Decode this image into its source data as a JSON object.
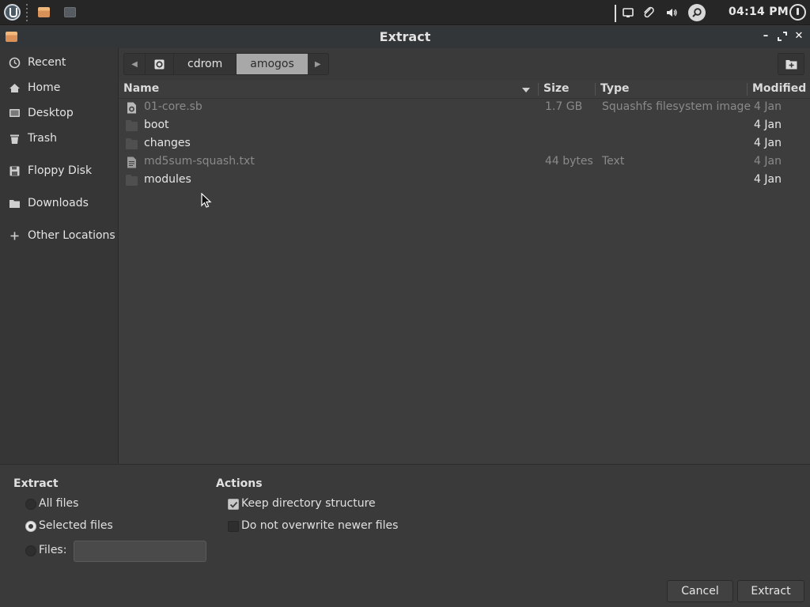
{
  "panel": {
    "clock": "04:14 PM",
    "tray_icons": [
      "screen-icon",
      "paperclip-icon",
      "volume-icon",
      "search-icon"
    ]
  },
  "window": {
    "title": "Extract",
    "controls": [
      "minimize",
      "maximize",
      "close"
    ]
  },
  "sidebar": {
    "items": [
      {
        "label": "Recent",
        "icon": "clock-icon"
      },
      {
        "label": "Home",
        "icon": "home-icon"
      },
      {
        "label": "Desktop",
        "icon": "desktop-icon"
      },
      {
        "label": "Trash",
        "icon": "trash-icon"
      },
      {
        "label": "Floppy Disk",
        "icon": "floppy-icon"
      },
      {
        "label": "Downloads",
        "icon": "folder-icon"
      },
      {
        "label": "Other Locations",
        "icon": "plus-icon"
      }
    ]
  },
  "pathbar": {
    "segments": [
      "cdrom",
      "amogos"
    ],
    "active": "amogos"
  },
  "filelist": {
    "columns": {
      "name": "Name",
      "size": "Size",
      "type": "Type",
      "modified": "Modified"
    },
    "rows": [
      {
        "name": "01-core.sb",
        "size": "1.7 GB",
        "type": "Squashfs filesystem image",
        "modified": "4 Jan",
        "kind": "file",
        "dimmed": true
      },
      {
        "name": "boot",
        "size": "",
        "type": "",
        "modified": "4 Jan",
        "kind": "folder",
        "dimmed": false
      },
      {
        "name": "changes",
        "size": "",
        "type": "",
        "modified": "4 Jan",
        "kind": "folder",
        "dimmed": false
      },
      {
        "name": "md5sum-squash.txt",
        "size": "44 bytes",
        "type": "Text",
        "modified": "4 Jan",
        "kind": "text",
        "dimmed": true
      },
      {
        "name": "modules",
        "size": "",
        "type": "",
        "modified": "4 Jan",
        "kind": "folder",
        "dimmed": false
      }
    ]
  },
  "extract": {
    "heading": "Extract",
    "all_files": "All files",
    "selected_files": "Selected files",
    "files_label": "Files:",
    "files_value": "",
    "selected_option": "Selected files"
  },
  "actions": {
    "heading": "Actions",
    "keep_structure": "Keep directory structure",
    "keep_structure_checked": true,
    "no_overwrite": "Do not overwrite newer files",
    "no_overwrite_checked": false
  },
  "buttons": {
    "cancel": "Cancel",
    "extract": "Extract"
  }
}
